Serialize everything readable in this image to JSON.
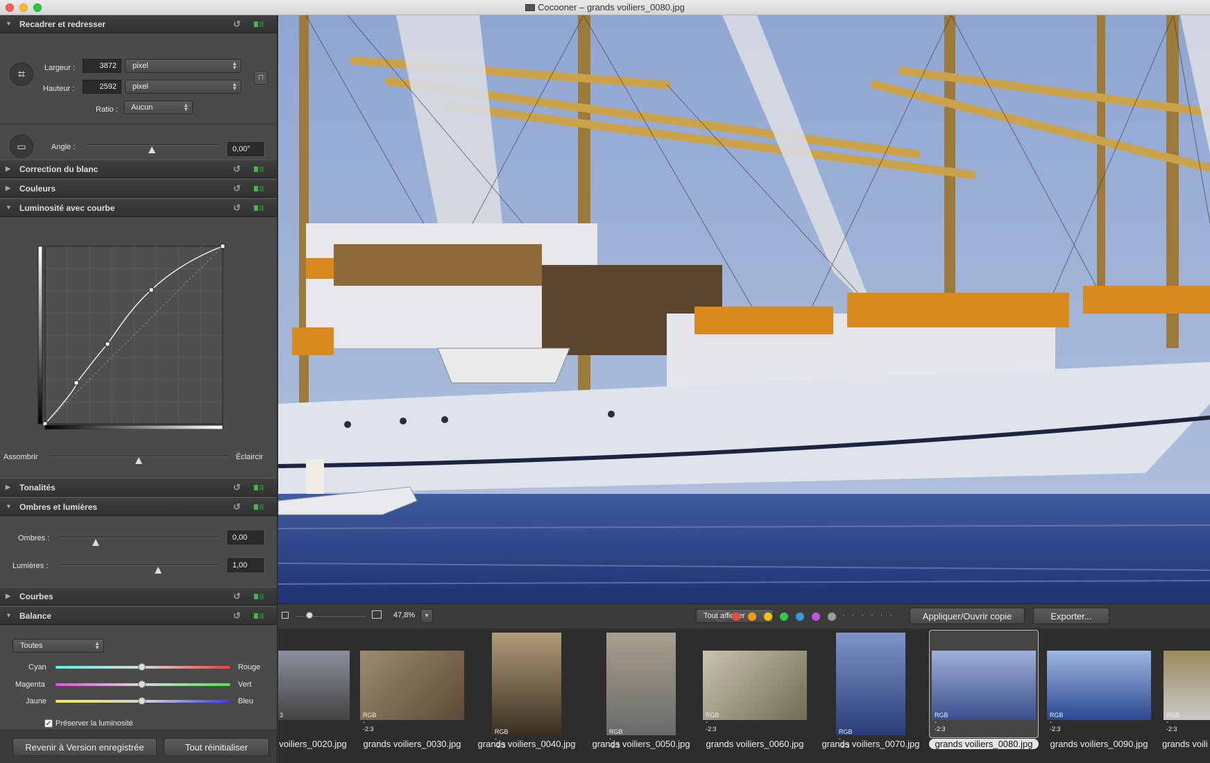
{
  "window": {
    "title": "Cocooner – grands voiliers_0080.jpg"
  },
  "sections": {
    "crop": {
      "label": "Recadrer et redresser",
      "width_label": "Largeur :",
      "width_value": "3872",
      "width_unit": "pixel",
      "height_label": "Hauteur :",
      "height_value": "2592",
      "height_unit": "pixel",
      "ratio_label": "Ratio :",
      "ratio_value": "Aucun",
      "angle_label": "Angle :",
      "angle_value": "0,00°",
      "angle_level": 0.5
    },
    "white": {
      "label": "Correction du blanc"
    },
    "colors": {
      "label": "Couleurs"
    },
    "curve": {
      "label": "Luminosité avec courbe",
      "darken": "Assombrir",
      "lighten": "Éclaircir",
      "slider_level": 0.5
    },
    "tones": {
      "label": "Tonalités"
    },
    "shadows": {
      "label": "Ombres et lumières",
      "shadows_label": "Ombres :",
      "shadows_value": "0,00",
      "shadows_level": 0.22,
      "lights_label": "Lumières :",
      "lights_value": "1,00",
      "lights_level": 0.62
    },
    "curves": {
      "label": "Courbes"
    },
    "balance": {
      "label": "Balance",
      "range": "Toutes",
      "cyan": "Cyan",
      "red": "Rouge",
      "magenta": "Magenta",
      "green": "Vert",
      "yellow": "Jaune",
      "blue": "Bleu",
      "preserve": "Préserver la luminosité"
    }
  },
  "buttons": {
    "revert": "Revenir à Version enregistrée",
    "reset": "Tout réinitialiser",
    "apply": "Appliquer/Ouvrir copie",
    "export": "Exporter..."
  },
  "toolbar": {
    "zoom": "47,8%",
    "filter": "Tout afficher"
  },
  "label_colors": [
    "#e74c3c",
    "#f39c12",
    "#f1c40f",
    "#2ecc40",
    "#3498db",
    "#c054e0",
    "#9a9a9a"
  ],
  "thumbnails": [
    {
      "name": "voiliers_0020.jpg",
      "info": "3"
    },
    {
      "name": "grands voiliers_0030.jpg",
      "info": "RGB - -2:3"
    },
    {
      "name": "grands voiliers_0040.jpg",
      "info": "RGB - -2:3"
    },
    {
      "name": "grands voiliers_0050.jpg",
      "info": "RGB - -2:3"
    },
    {
      "name": "grands voiliers_0060.jpg",
      "info": "RGB - -2:3"
    },
    {
      "name": "grands voiliers_0070.jpg",
      "info": "RGB - -2:3"
    },
    {
      "name": "grands voiliers_0080.jpg",
      "info": "RGB - -2:3"
    },
    {
      "name": "grands voiliers_0090.jpg",
      "info": "RGB - -2:3"
    },
    {
      "name": "grands voili",
      "info": "RGB - -2:3"
    }
  ]
}
